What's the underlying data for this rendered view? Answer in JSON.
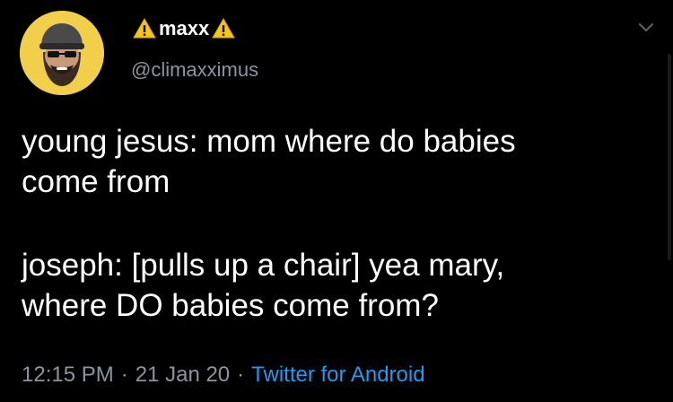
{
  "author": {
    "display_name": "maxx",
    "handle": "@climaxximus",
    "name_icons": [
      "warning-icon",
      "warning-icon"
    ]
  },
  "tweet": {
    "paragraph_1": "young jesus: mom where do babies\ncome from",
    "paragraph_2": "joseph: [pulls up a chair] yea mary,\nwhere DO babies come from?"
  },
  "meta": {
    "time": "12:15 PM",
    "date": "21 Jan 20",
    "separator": "·",
    "source": "Twitter for Android"
  },
  "colors": {
    "background": "#000000",
    "text": "#ffffff",
    "secondary": "#8b949e",
    "link": "#1d9bf0",
    "avatar_bg": "#f2cf4a",
    "warning": "#f5c518"
  },
  "icons": {
    "menu": "chevron-down-icon"
  }
}
